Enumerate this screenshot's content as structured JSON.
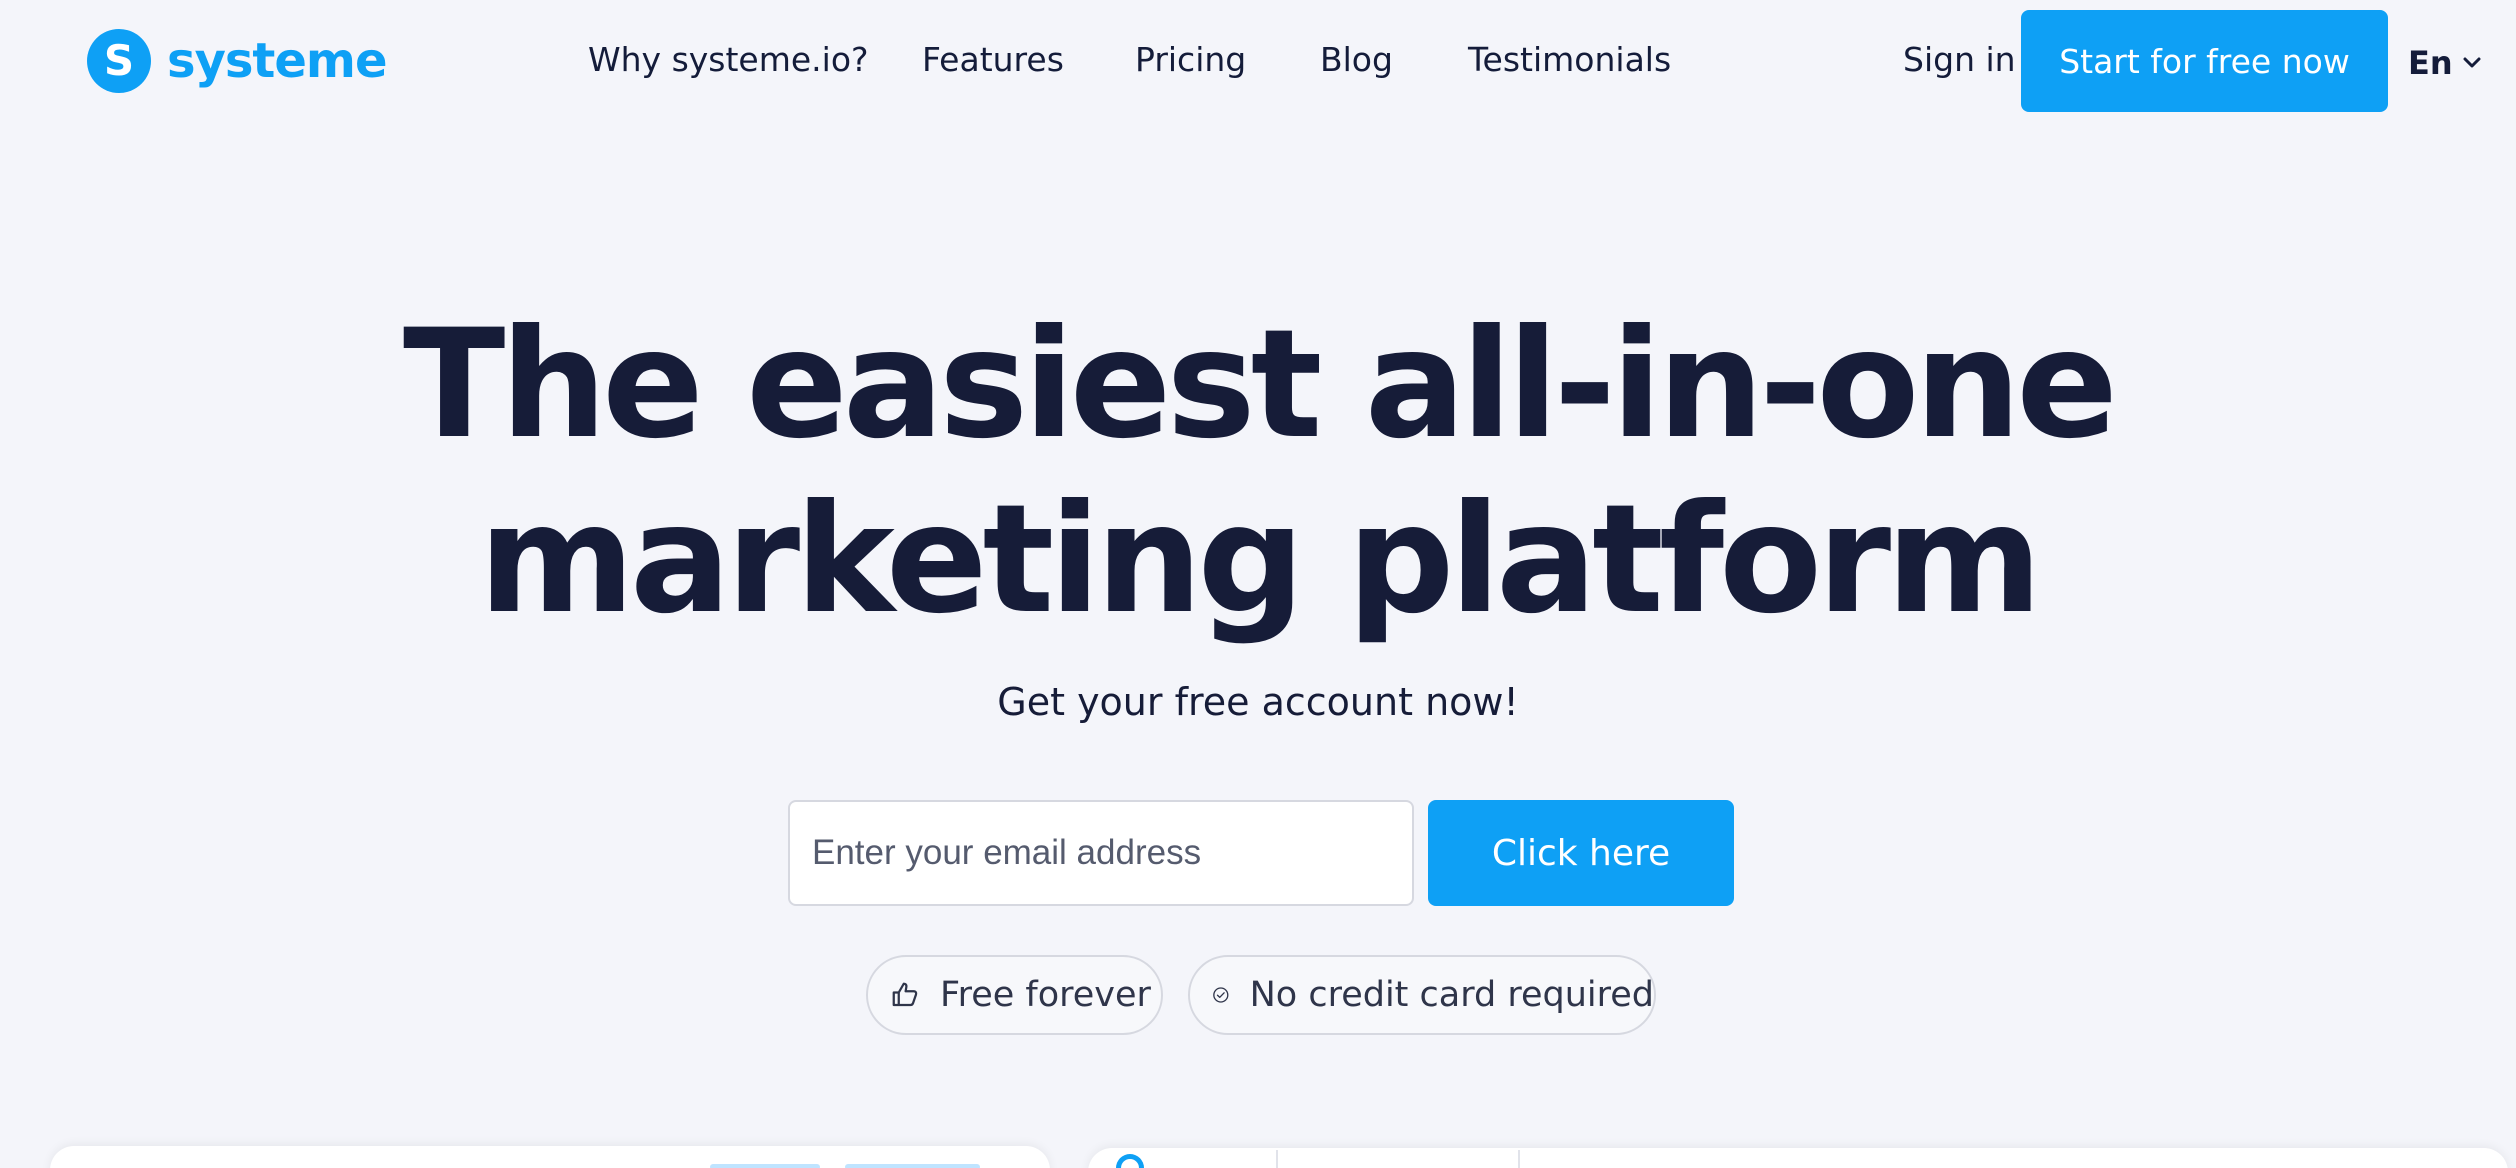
{
  "brand": {
    "name": "systeme",
    "mark": "S",
    "color": "#0ea0f5",
    "icon": "systeme-logo-icon"
  },
  "nav": {
    "items": [
      {
        "label": "Why systeme.io?"
      },
      {
        "label": "Features"
      },
      {
        "label": "Pricing"
      },
      {
        "label": "Blog"
      },
      {
        "label": "Testimonials"
      }
    ],
    "sign_in": "Sign in",
    "cta": "Start for free now",
    "language": "En",
    "language_icon": "chevron-down-icon"
  },
  "hero": {
    "title_line1": "The easiest all-in-one",
    "title_highlight": "marketing",
    "title_rest": " platform",
    "highlight_color": "#b5f57a",
    "subtitle": "Get your free account now!",
    "email_placeholder": "Enter your email address",
    "email_value": "",
    "submit_label": "Click here",
    "badges": [
      {
        "icon": "thumbs-up-icon",
        "label": "Free forever"
      },
      {
        "icon": "check-circle-icon",
        "label": "No credit card required"
      }
    ]
  },
  "colors": {
    "primary": "#0ea0f5",
    "text": "#161c38",
    "background": "#f4f5fa"
  }
}
